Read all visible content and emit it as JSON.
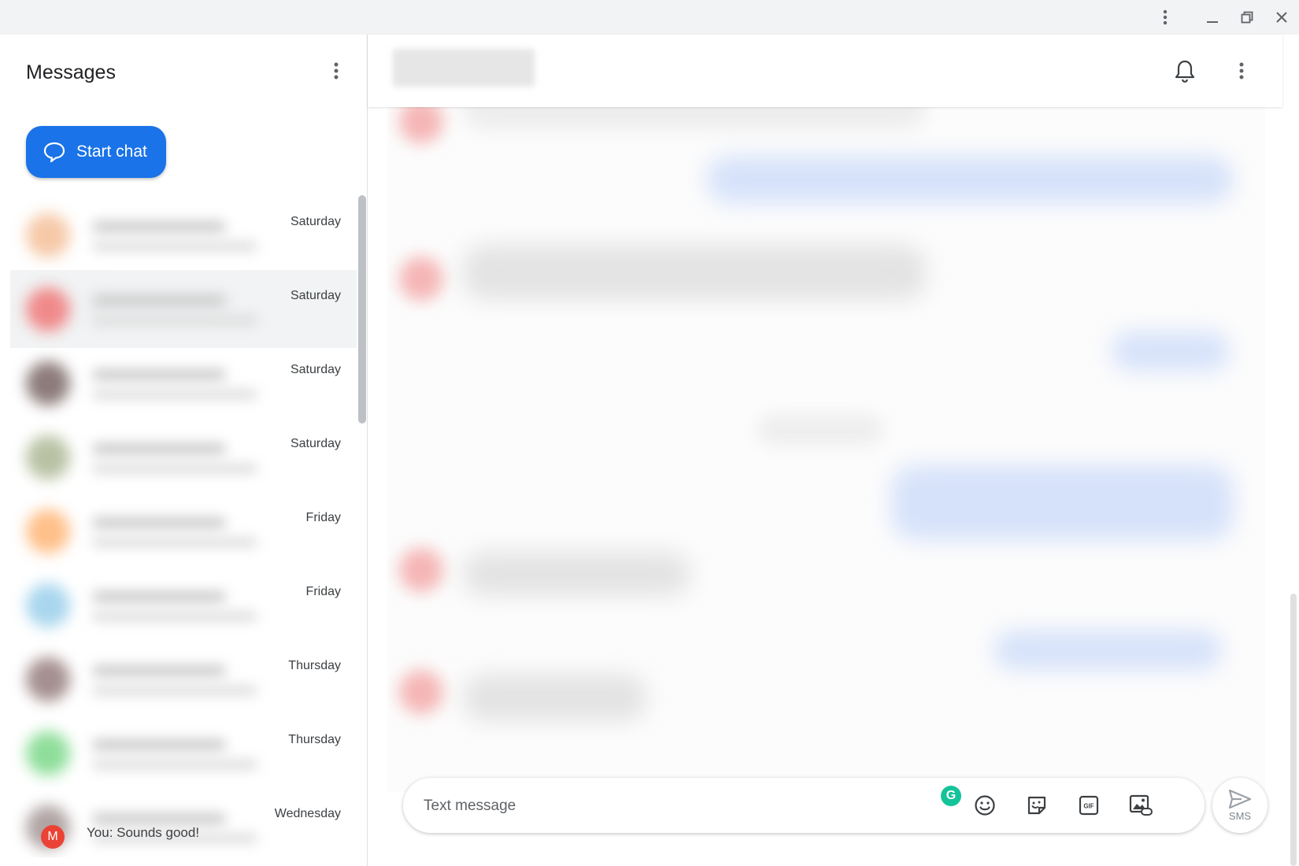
{
  "app": {
    "title": "Messages"
  },
  "left": {
    "start_chat_label": "Start chat",
    "conversations": [
      {
        "date": "Saturday",
        "avatar_color": "#f6c9a8"
      },
      {
        "date": "Saturday",
        "avatar_color": "#f08a8a",
        "selected": true
      },
      {
        "date": "Saturday",
        "avatar_color": "#8d7b7b"
      },
      {
        "date": "Saturday",
        "avatar_color": "#b9c2a4"
      },
      {
        "date": "Friday",
        "avatar_color": "#ffc08a"
      },
      {
        "date": "Friday",
        "avatar_color": "#a9d6ee"
      },
      {
        "date": "Thursday",
        "avatar_color": "#a58f8f"
      },
      {
        "date": "Thursday",
        "avatar_color": "#8fde9a"
      },
      {
        "date": "Wednesday",
        "avatar_color": "#b0a4a4"
      }
    ],
    "partial": {
      "avatar_initial": "M",
      "snippet": "You: Sounds good!"
    }
  },
  "composer": {
    "placeholder": "Text message",
    "send_label": "SMS",
    "grammarly_letter": "G"
  },
  "colors": {
    "accent": "#1a73e8",
    "selected_row": "#f1f3f4",
    "grammarly": "#15c39a",
    "avatar_red": "#ea4335"
  },
  "icons": [
    "more-vert-icon",
    "minimize-icon",
    "restore-icon",
    "close-icon",
    "chat-bubble-icon",
    "bell-icon",
    "emoji-icon",
    "sticker-icon",
    "gif-icon",
    "attach-image-icon",
    "send-icon"
  ]
}
